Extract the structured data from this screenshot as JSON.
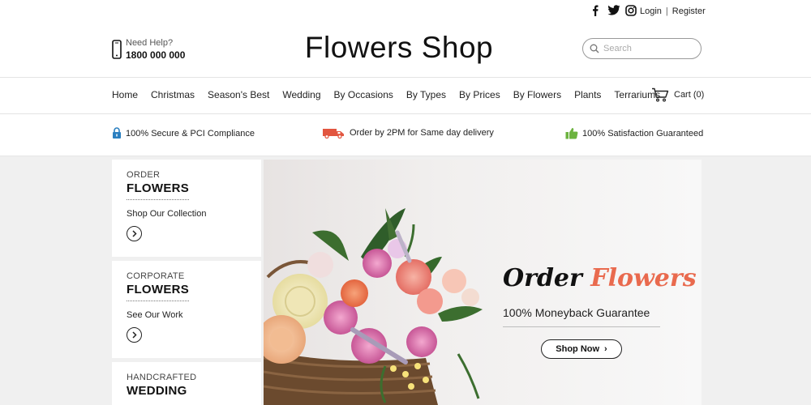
{
  "topbar": {
    "social": [
      "facebook-icon",
      "twitter-icon",
      "instagram-icon"
    ],
    "login": "Login",
    "separator": "|",
    "register": "Register"
  },
  "header": {
    "help_label": "Need Help?",
    "phone": "1800 000 000",
    "logo": "Flowers Shop",
    "search_placeholder": "Search"
  },
  "nav": {
    "items": [
      "Home",
      "Christmas",
      "Season's Best",
      "Wedding",
      "By Occasions",
      "By Types",
      "By Prices",
      "By Flowers",
      "Plants",
      "Terrariums"
    ],
    "cart": "Cart (0)"
  },
  "features": {
    "secure": "100% Secure & PCI Compliance",
    "delivery": "Order by 2PM for Same day delivery",
    "satisfaction": "100% Satisfaction Guaranteed"
  },
  "sidebar": {
    "cards": [
      {
        "kicker": "ORDER",
        "title": "FLOWERS",
        "link": "Shop Our Collection"
      },
      {
        "kicker": "CORPORATE",
        "title": "FLOWERS",
        "link": "See Our Work"
      },
      {
        "kicker": "HANDCRAFTED",
        "title": "WEDDING"
      }
    ]
  },
  "banner": {
    "title_word1": "Order",
    "title_word2": "Flowers",
    "subtitle": "100% Moneyback Guarantee",
    "button": "Shop Now"
  },
  "colors": {
    "accent_coral": "#e96a4e",
    "lock_blue": "#2a7fc0",
    "truck_red": "#e2553f",
    "thumb_green": "#6cb33f"
  }
}
